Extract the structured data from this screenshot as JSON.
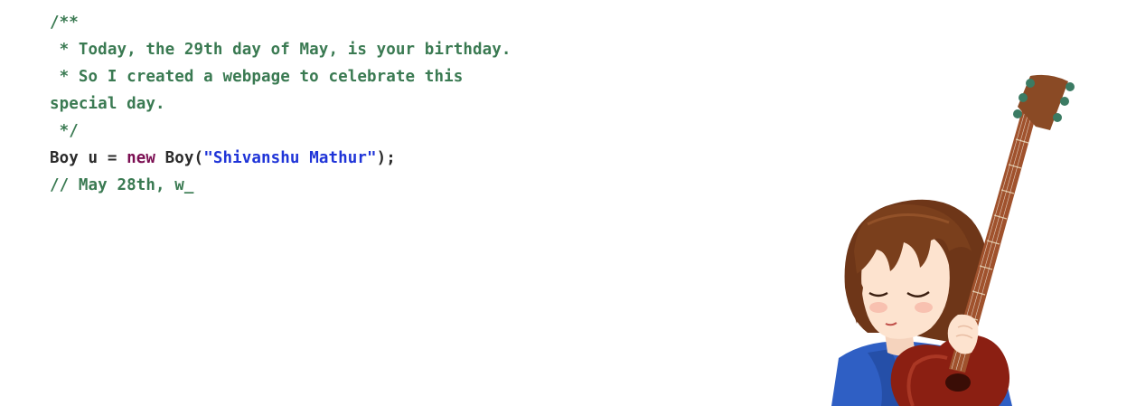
{
  "code": {
    "comment_open": "/**",
    "comment_line1": " * Today, the 29th day of May, is your birthday.",
    "comment_line2": " * So I created a webpage to celebrate this special day.",
    "comment_close": " */",
    "stmt_type": "Boy u = ",
    "stmt_keyword": "new",
    "stmt_ctor": " Boy(",
    "stmt_string": "\"Shivanshu Mathur\"",
    "stmt_end": ");",
    "typing_line": "// May 28th, w",
    "cursor": "_"
  },
  "illustration": {
    "icon": "girl-with-guitar-illustration",
    "colors": {
      "hair": "#7a3f1c",
      "skin": "#fde3cf",
      "shirt": "#2f5fc4",
      "guitar_body": "#8b1f12",
      "guitar_neck": "#a0522d"
    }
  }
}
